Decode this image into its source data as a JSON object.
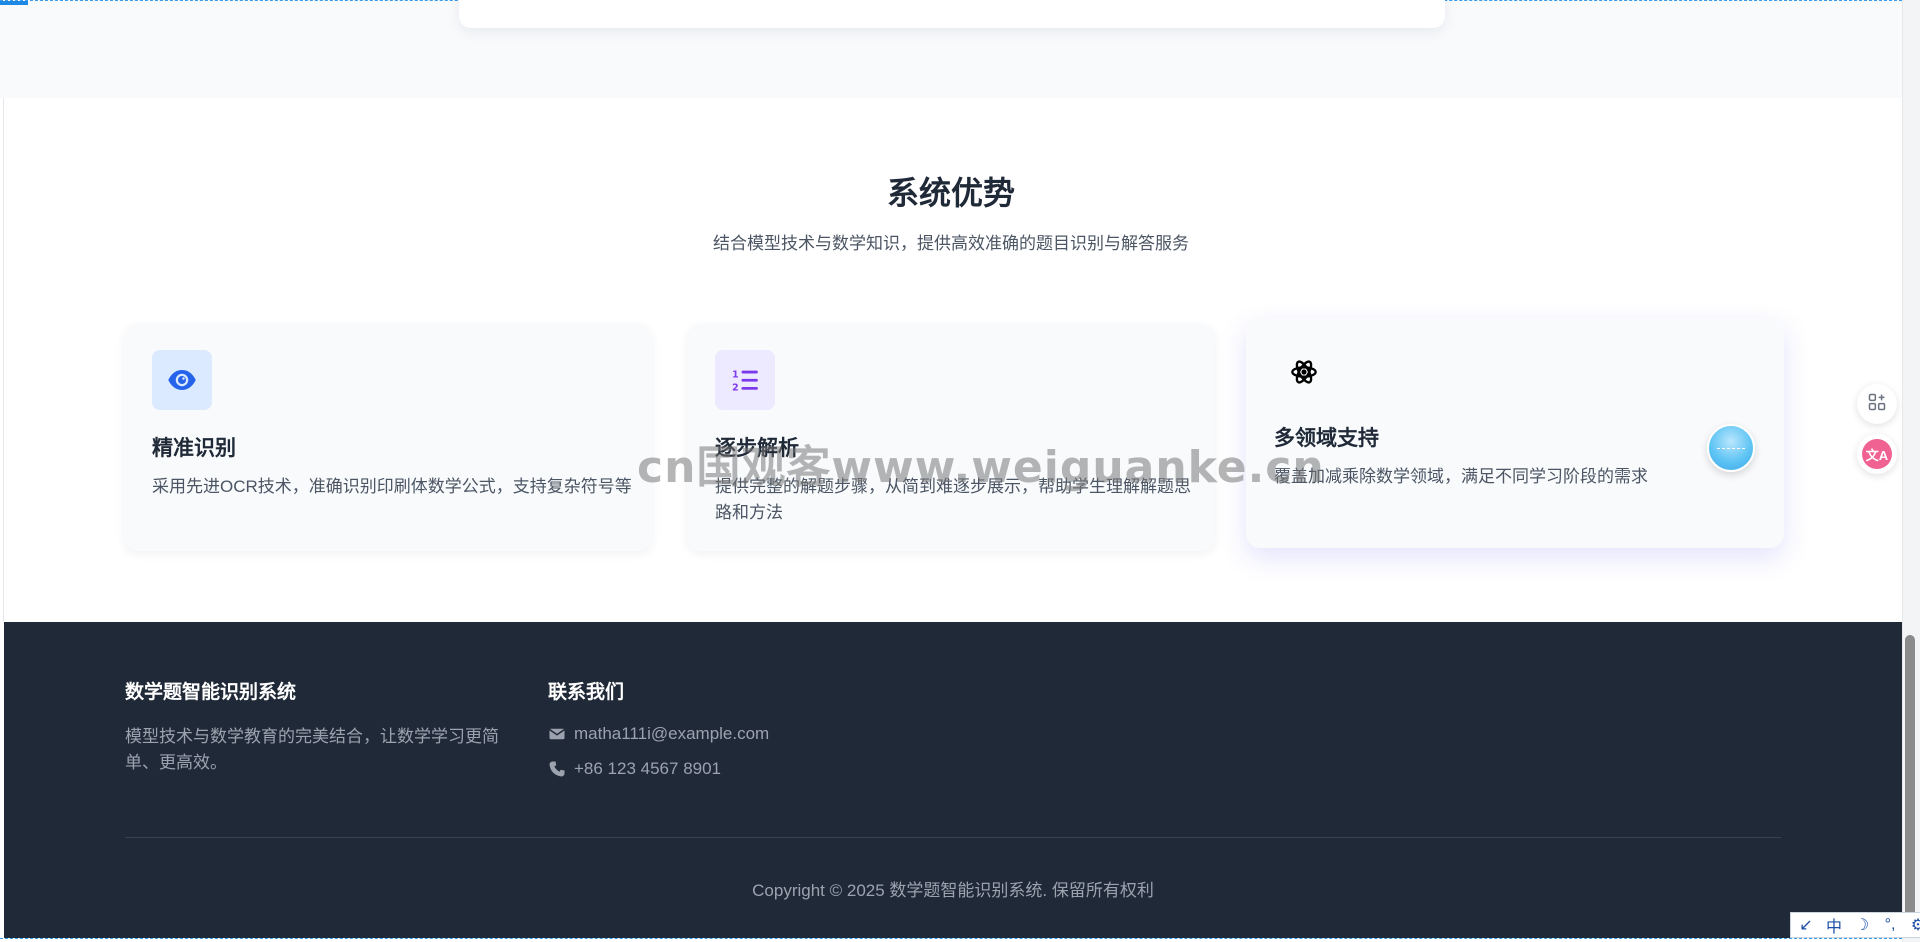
{
  "section": {
    "title": "系统优势",
    "subtitle": "结合模型技术与数学知识，提供高效准确的题目识别与解答服务"
  },
  "features": [
    {
      "icon": "eye-icon",
      "title": "精准识别",
      "description": "采用先进OCR技术，准确识别印刷体数学公式，支持复杂符号等"
    },
    {
      "icon": "ordered-list-icon",
      "title": "逐步解析",
      "description": "提供完整的解题步骤，从简到难逐步展示，帮助学生理解解题思路和方法"
    },
    {
      "icon": "atom-icon",
      "title": "多领域支持",
      "description": "覆盖加减乘除数学领域，满足不同学习阶段的需求"
    }
  ],
  "watermark": "cn国观客www.weiguanke.cn",
  "footer": {
    "brand_title": "数学题智能识别系统",
    "brand_desc": "模型技术与数学教育的完美结合，让数学学习更简单、更高效。",
    "contact_title": "联系我们",
    "email": "matha111i@example.com",
    "phone": "+86 123 4567 8901",
    "copyright": "Copyright © 2025 数学题智能识别系统. 保留所有权利"
  },
  "side_tools": {
    "translate_label": "文A"
  },
  "ime_bar": {
    "items": [
      "↙",
      "中",
      "☽",
      "°,",
      "⚙"
    ]
  },
  "colors": {
    "footer_bg": "#1f2937",
    "eye_icon": "#2563eb",
    "list_icon": "#7c3aed"
  }
}
